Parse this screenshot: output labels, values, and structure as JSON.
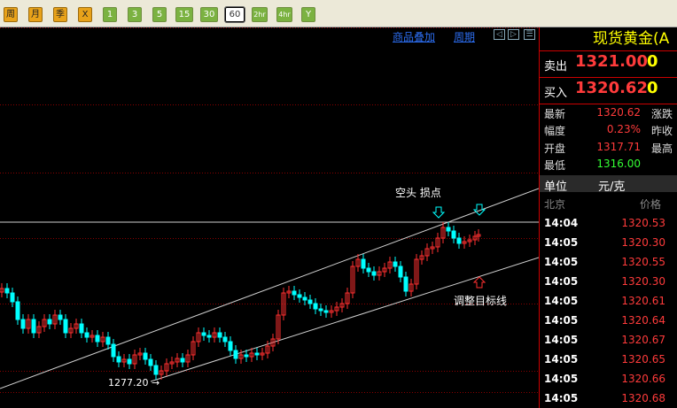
{
  "toolbar": {
    "buttons": [
      {
        "label": "周",
        "style": "orange"
      },
      {
        "label": "月",
        "style": "orange"
      },
      {
        "label": "季",
        "style": "orange"
      },
      {
        "label": "X",
        "style": "orange"
      },
      {
        "label": "1",
        "style": "green"
      },
      {
        "label": "3",
        "style": "green"
      },
      {
        "label": "5",
        "style": "green"
      },
      {
        "label": "15",
        "style": "green"
      },
      {
        "label": "30",
        "style": "green"
      },
      {
        "label": "60",
        "style": "active"
      },
      {
        "label": "2hr",
        "style": "green"
      },
      {
        "label": "4hr",
        "style": "green"
      },
      {
        "label": "Y",
        "style": "green"
      }
    ]
  },
  "chart_header": {
    "overlay_link": "商品叠加",
    "period_link": "周期"
  },
  "chart_data": {
    "type": "candlestick",
    "annotations": {
      "short_stop": "空头 损点",
      "adjust_target": "调整目标线",
      "low_label": "1277.20"
    },
    "low_value": 1277.2,
    "colors": {
      "up": "#ff3030",
      "down": "#00ffff",
      "channel": "#d0d0d0",
      "grid": "#8b0000"
    }
  },
  "panel": {
    "title": "现货黄金(A",
    "sell_label": "卖出",
    "sell_price": "1321.00",
    "sell_vol": "0",
    "buy_label": "买入",
    "buy_price": "1320.62",
    "buy_vol": "0",
    "stats": [
      {
        "label": "最新",
        "value": "1320.62",
        "color": "#ff3b3b",
        "label2": "涨跌"
      },
      {
        "label": "幅度",
        "value": "0.23%",
        "color": "#ff3b3b",
        "label2": "昨收"
      },
      {
        "label": "开盘",
        "value": "1317.71",
        "color": "#ff3b3b",
        "label2": "最高"
      },
      {
        "label": "最低",
        "value": "1316.00",
        "color": "#33ff33",
        "label2": ""
      }
    ],
    "unit_label": "单位",
    "unit_value": "元/克",
    "city": "北京",
    "price_header": "价格",
    "ticks": [
      {
        "time": "14:04",
        "price": "1320.53"
      },
      {
        "time": "14:05",
        "price": "1320.30"
      },
      {
        "time": "14:05",
        "price": "1320.55"
      },
      {
        "time": "14:05",
        "price": "1320.30"
      },
      {
        "time": "14:05",
        "price": "1320.61"
      },
      {
        "time": "14:05",
        "price": "1320.64"
      },
      {
        "time": "14:05",
        "price": "1320.67"
      },
      {
        "time": "14:05",
        "price": "1320.65"
      },
      {
        "time": "14:05",
        "price": "1320.66"
      },
      {
        "time": "14:05",
        "price": "1320.68"
      }
    ]
  }
}
